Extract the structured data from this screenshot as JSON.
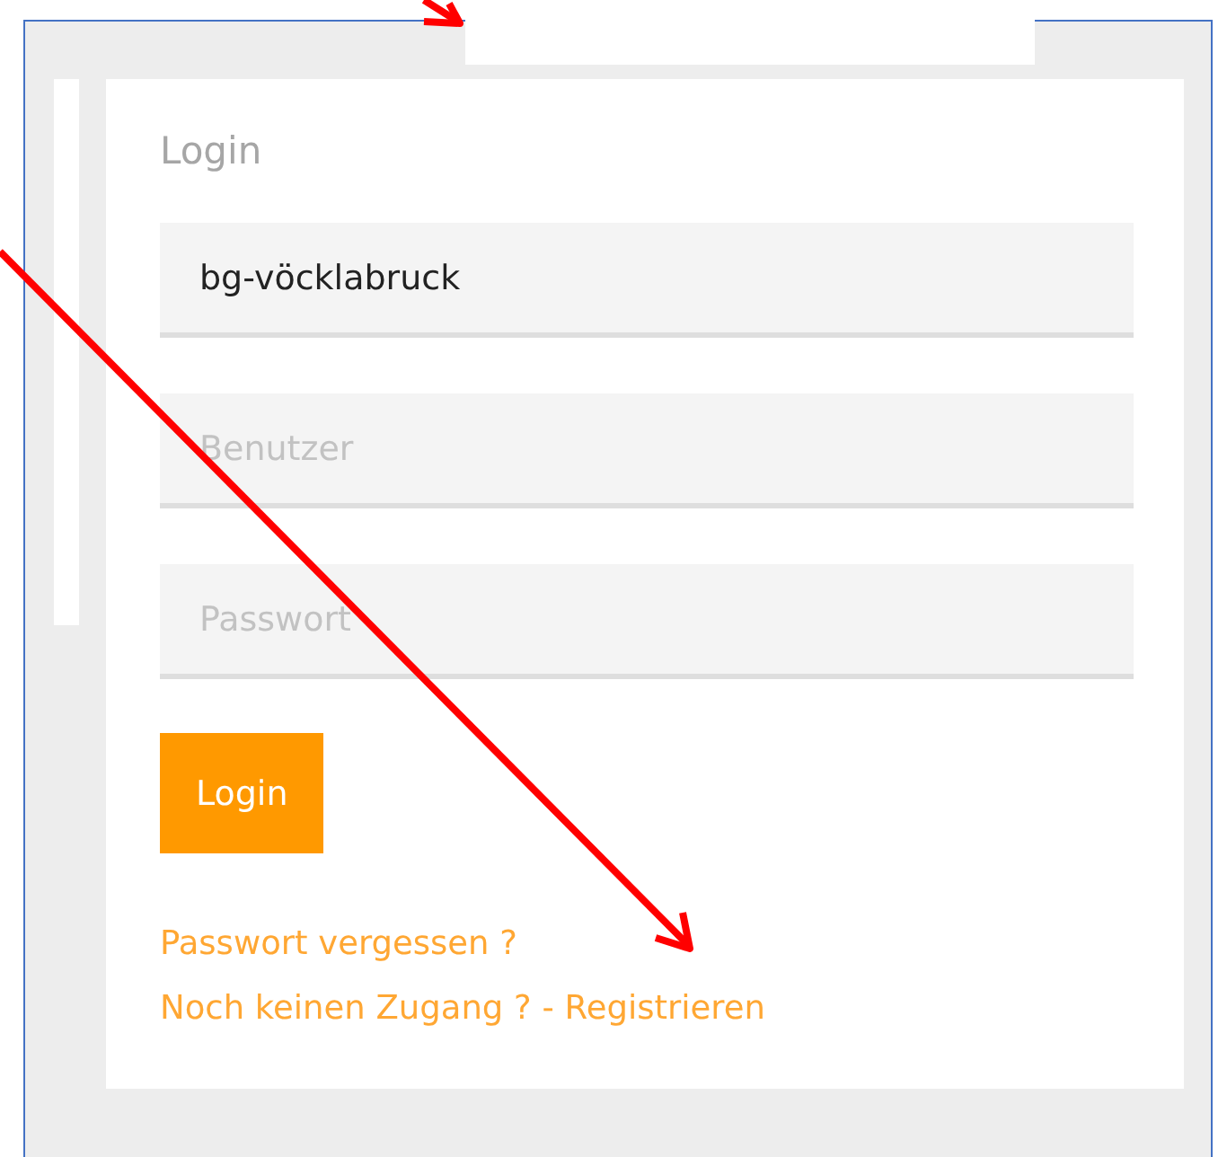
{
  "login": {
    "title": "Login",
    "fields": [
      {
        "kind": "text",
        "value": "bg-vöcklabruck"
      },
      {
        "kind": "text",
        "placeholder": "Benutzer"
      },
      {
        "kind": "password",
        "placeholder": "Passwort"
      }
    ],
    "button": "Login",
    "links": [
      "Passwort vergessen ?",
      "Noch keinen Zugang ? - Registrieren"
    ]
  }
}
